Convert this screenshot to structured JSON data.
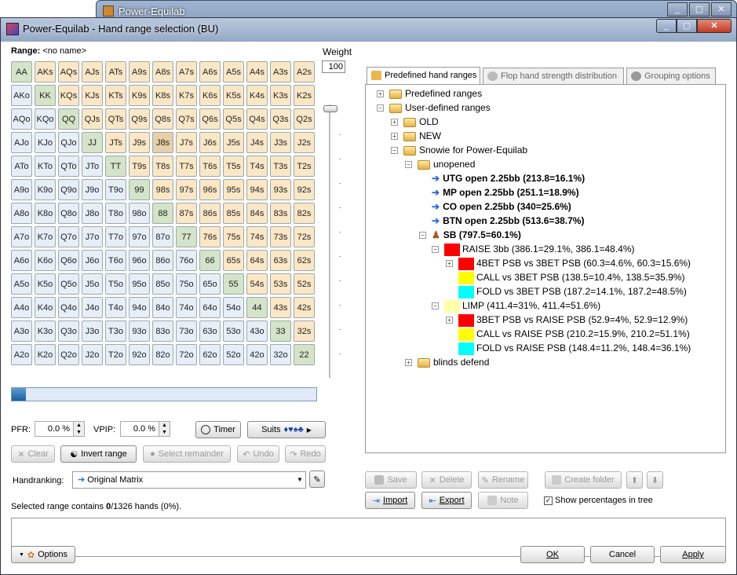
{
  "bg_window": {
    "title": "Power-Equilab"
  },
  "window": {
    "title": "Power-Equilab - Hand range selection (BU)",
    "min": "_",
    "max": "▢",
    "close": "✕"
  },
  "range": {
    "label": "Range:",
    "name": "<no name>"
  },
  "weight": {
    "label": "Weight",
    "value": "100"
  },
  "matrix": [
    [
      "AA",
      "AKs",
      "AQs",
      "AJs",
      "ATs",
      "A9s",
      "A8s",
      "A7s",
      "A6s",
      "A5s",
      "A4s",
      "A3s",
      "A2s"
    ],
    [
      "AKo",
      "KK",
      "KQs",
      "KJs",
      "KTs",
      "K9s",
      "K8s",
      "K7s",
      "K6s",
      "K5s",
      "K4s",
      "K3s",
      "K2s"
    ],
    [
      "AQo",
      "KQo",
      "QQ",
      "QJs",
      "QTs",
      "Q9s",
      "Q8s",
      "Q7s",
      "Q6s",
      "Q5s",
      "Q4s",
      "Q3s",
      "Q2s"
    ],
    [
      "AJo",
      "KJo",
      "QJo",
      "JJ",
      "JTs",
      "J9s",
      "J8s",
      "J7s",
      "J6s",
      "J5s",
      "J4s",
      "J3s",
      "J2s"
    ],
    [
      "ATo",
      "KTo",
      "QTo",
      "JTo",
      "TT",
      "T9s",
      "T8s",
      "T7s",
      "T6s",
      "T5s",
      "T4s",
      "T3s",
      "T2s"
    ],
    [
      "A9o",
      "K9o",
      "Q9o",
      "J9o",
      "T9o",
      "99",
      "98s",
      "97s",
      "96s",
      "95s",
      "94s",
      "93s",
      "92s"
    ],
    [
      "A8o",
      "K8o",
      "Q8o",
      "J8o",
      "T8o",
      "98o",
      "88",
      "87s",
      "86s",
      "85s",
      "84s",
      "83s",
      "82s"
    ],
    [
      "A7o",
      "K7o",
      "Q7o",
      "J7o",
      "T7o",
      "97o",
      "87o",
      "77",
      "76s",
      "75s",
      "74s",
      "73s",
      "72s"
    ],
    [
      "A6o",
      "K6o",
      "Q6o",
      "J6o",
      "T6o",
      "96o",
      "86o",
      "76o",
      "66",
      "65s",
      "64s",
      "63s",
      "62s"
    ],
    [
      "A5o",
      "K5o",
      "Q5o",
      "J5o",
      "T5o",
      "95o",
      "85o",
      "75o",
      "65o",
      "55",
      "54s",
      "53s",
      "52s"
    ],
    [
      "A4o",
      "K4o",
      "Q4o",
      "J4o",
      "T4o",
      "94o",
      "84o",
      "74o",
      "64o",
      "54o",
      "44",
      "43s",
      "42s"
    ],
    [
      "A3o",
      "K3o",
      "Q3o",
      "J3o",
      "T3o",
      "93o",
      "83o",
      "73o",
      "63o",
      "53o",
      "43o",
      "33",
      "32s"
    ],
    [
      "A2o",
      "K2o",
      "Q2o",
      "J2o",
      "T2o",
      "92o",
      "82o",
      "72o",
      "62o",
      "52o",
      "42o",
      "32o",
      "22"
    ]
  ],
  "stats": {
    "pfr_label": "PFR:",
    "pfr_value": "0.0 %",
    "vpip_label": "VPIP:",
    "vpip_value": "0.0 %"
  },
  "buttons": {
    "timer": "Timer",
    "suits": "Suits",
    "clear": "Clear",
    "invert": "Invert range",
    "select_remainder": "Select remainder",
    "undo": "Undo",
    "redo": "Redo",
    "options": "Options",
    "ok": "OK",
    "cancel": "Cancel",
    "apply": "Apply",
    "save": "Save",
    "delete": "Delete",
    "rename": "Rename",
    "create_folder": "Create folder",
    "import": "Import",
    "export": "Export",
    "note": "Note"
  },
  "suits_glyphs": "♦♥♠♣",
  "handranking": {
    "label": "Handranking:",
    "value": "Original Matrix"
  },
  "summary": {
    "prefix": "Selected range contains ",
    "count": "0",
    "suffix": "/1326 hands (0%)."
  },
  "tabs": [
    "Predefined hand ranges",
    "Flop hand strength distribution",
    "Grouping options"
  ],
  "tree": [
    {
      "label": "Predefined ranges"
    },
    {
      "label": "User-defined ranges"
    },
    {
      "label": "OLD"
    },
    {
      "label": "NEW"
    },
    {
      "label": "Snowie for Power-Equilab"
    },
    {
      "label": "unopened"
    },
    {
      "label": "UTG open 2.25bb (213.8=16.1%)"
    },
    {
      "label": "MP open 2.25bb (251.1=18.9%)"
    },
    {
      "label": "CO open 2.25bb (340=25.6%)"
    },
    {
      "label": "BTN open 2.25bb (513.6=38.7%)"
    },
    {
      "label": "SB (797.5=60.1%)"
    },
    {
      "label": "RAISE 3bb (386.1=29.1%, 386.1=48.4%)",
      "color": "#ff0000"
    },
    {
      "label": "4BET PSB vs 3BET PSB (60.3=4.6%, 60.3=15.6%)",
      "color": "#ff0000"
    },
    {
      "label": "CALL vs 3BET PSB (138.5=10.4%, 138.5=35.9%)",
      "color": "#ffff00"
    },
    {
      "label": "FOLD vs 3BET PSB (187.2=14.1%, 187.2=48.5%)",
      "color": "#00ffff"
    },
    {
      "label": "LIMP (411.4=31%, 411.4=51.6%)",
      "color": "#ffffaa"
    },
    {
      "label": "3BET PSB vs RAISE PSB (52.9=4%, 52.9=12.9%)",
      "color": "#ff0000"
    },
    {
      "label": "CALL vs RAISE PSB (210.2=15.9%, 210.2=51.1%)",
      "color": "#ffff00"
    },
    {
      "label": "FOLD vs RAISE PSB (148.4=11.2%, 148.4=36.1%)",
      "color": "#00ffff"
    },
    {
      "label": "blinds defend"
    }
  ],
  "show_percentages": "Show percentages in tree"
}
